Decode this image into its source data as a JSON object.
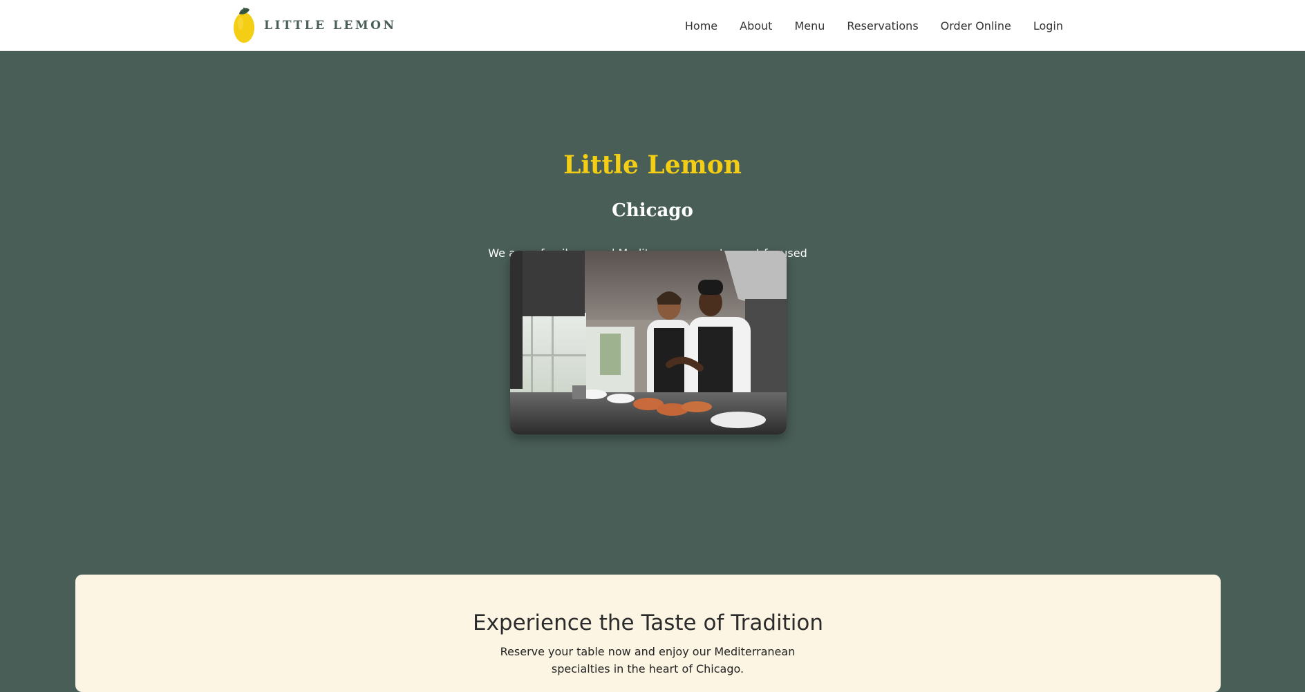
{
  "nav": {
    "logo_text": "LITTLE LEMON",
    "links": [
      "Home",
      "About",
      "Menu",
      "Reservations",
      "Order Online",
      "Login"
    ]
  },
  "hero": {
    "title": "Little Lemon",
    "subtitle": "Chicago",
    "description": "We are a family owned Mediterranean restaurant focused on traditional recipes served with a modern twist.",
    "image_label": "chefs-in-kitchen-photo"
  },
  "cta": {
    "title": "Experience the Taste of Tradition",
    "text": "Reserve your table now and enjoy our Mediterranean specialties in the heart of Chicago."
  },
  "colors": {
    "primary_green": "#495e57",
    "primary_yellow": "#f4ce14",
    "cream": "#fcf5e3",
    "white": "#ffffff"
  },
  "icons": {
    "logo": "lemon-icon"
  }
}
